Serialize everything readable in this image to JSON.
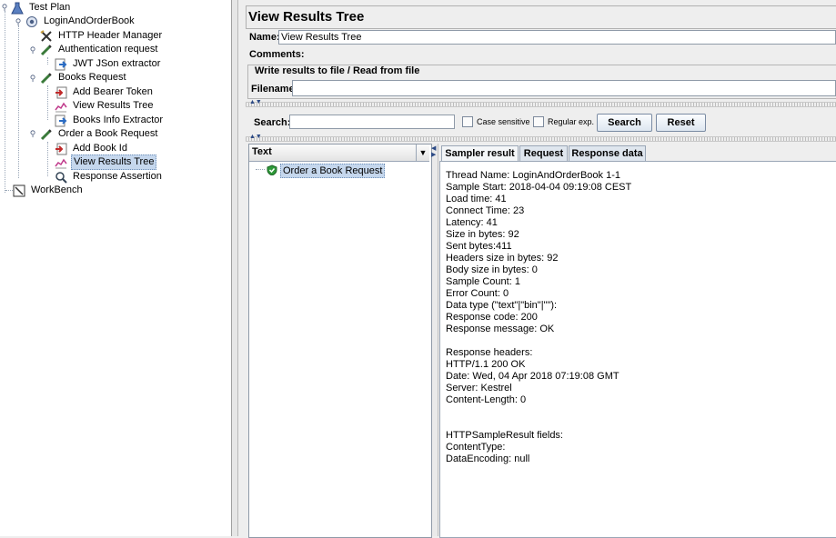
{
  "tree": {
    "items": [
      {
        "label": "Test Plan",
        "icon": "test-plan-icon"
      },
      {
        "label": "LoginAndOrderBook",
        "icon": "thread-group-icon"
      },
      {
        "label": "HTTP Header Manager",
        "icon": "header-manager-icon"
      },
      {
        "label": "Authentication request",
        "icon": "sampler-icon"
      },
      {
        "label": "JWT JSon extractor",
        "icon": "extractor-icon"
      },
      {
        "label": "Books Request",
        "icon": "sampler-icon"
      },
      {
        "label": "Add Bearer Token",
        "icon": "preprocessor-icon"
      },
      {
        "label": "View Results Tree",
        "icon": "results-tree-icon"
      },
      {
        "label": "Books Info Extractor",
        "icon": "extractor-icon"
      },
      {
        "label": "Order a Book Request",
        "icon": "sampler-icon"
      },
      {
        "label": "Add Book Id",
        "icon": "preprocessor-icon"
      },
      {
        "label": "View Results Tree",
        "icon": "results-tree-icon"
      },
      {
        "label": "Response Assertion",
        "icon": "assertion-icon"
      },
      {
        "label": "WorkBench",
        "icon": "workbench-icon"
      }
    ]
  },
  "panel": {
    "title": "View Results Tree",
    "name_label": "Name:",
    "name_value": "View Results Tree",
    "comments_label": "Comments:",
    "file_group_title": "Write results to file / Read from file",
    "filename_label": "Filename",
    "filename_value": ""
  },
  "search": {
    "label": "Search:",
    "value": "",
    "case_sensitive": "Case sensitive",
    "regular_exp": "Regular exp.",
    "search_button": "Search",
    "reset_button": "Reset"
  },
  "results": {
    "renderer": "Text",
    "sample_label": "Order a Book Request",
    "tabs": [
      "Sampler result",
      "Request",
      "Response data"
    ],
    "lines": [
      "Thread Name: LoginAndOrderBook 1-1",
      "Sample Start: 2018-04-04 09:19:08 CEST",
      "Load time: 41",
      "Connect Time: 23",
      "Latency: 41",
      "Size in bytes: 92",
      "Sent bytes:411",
      "Headers size in bytes: 92",
      "Body size in bytes: 0",
      "Sample Count: 1",
      "Error Count: 0",
      "Data type (\"text\"|\"bin\"|\"\"):",
      "Response code: 200",
      "Response message: OK",
      "",
      "Response headers:",
      "HTTP/1.1 200 OK",
      "Date: Wed, 04 Apr 2018 07:19:08 GMT",
      "Server: Kestrel",
      "Content-Length: 0",
      "",
      "",
      "HTTPSampleResult fields:",
      "ContentType:",
      "DataEncoding: null"
    ]
  }
}
